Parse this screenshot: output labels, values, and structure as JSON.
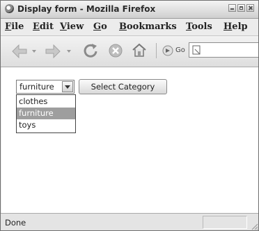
{
  "window": {
    "title": "Display form - Mozilla Firefox"
  },
  "menu": [
    "File",
    "Edit",
    "View",
    "Go",
    "Bookmarks",
    "Tools",
    "Help"
  ],
  "toolbar": {
    "icons": [
      "back-icon",
      "forward-icon",
      "reload-icon",
      "stop-icon",
      "home-icon",
      "go-icon",
      "address-page-icon"
    ],
    "go_label": "Go"
  },
  "form": {
    "select": {
      "value": "furniture",
      "options": [
        "clothes",
        "furniture",
        "toys"
      ],
      "highlighted": "furniture",
      "expanded": true
    },
    "submit_label": "Select Category"
  },
  "status": {
    "text": "Done"
  }
}
